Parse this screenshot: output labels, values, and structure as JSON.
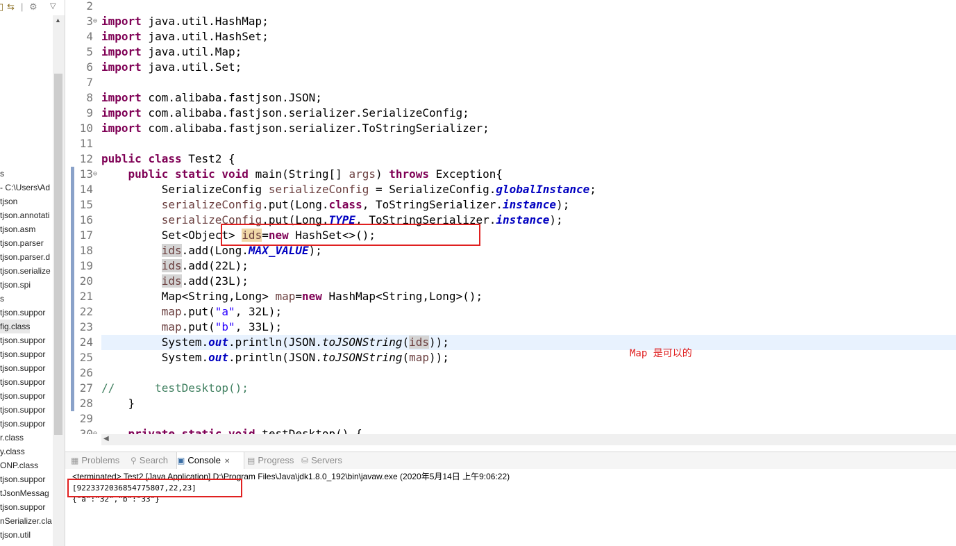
{
  "explorer": {
    "items": [
      {
        "label": "s",
        "selected": false
      },
      {
        "label": "- C:\\Users\\Ad",
        "selected": false
      },
      {
        "label": "tjson",
        "selected": false
      },
      {
        "label": "tjson.annotati",
        "selected": false
      },
      {
        "label": "tjson.asm",
        "selected": false
      },
      {
        "label": "tjson.parser",
        "selected": false
      },
      {
        "label": "tjson.parser.d",
        "selected": false
      },
      {
        "label": "tjson.serialize",
        "selected": false
      },
      {
        "label": "tjson.spi",
        "selected": false
      },
      {
        "label": "s",
        "selected": false
      },
      {
        "label": "tjson.suppor",
        "selected": false
      },
      {
        "label": "fig.class",
        "selected": true
      },
      {
        "label": "tjson.suppor",
        "selected": false
      },
      {
        "label": "tjson.suppor",
        "selected": false
      },
      {
        "label": "tjson.suppor",
        "selected": false
      },
      {
        "label": "tjson.suppor",
        "selected": false
      },
      {
        "label": "tjson.suppor",
        "selected": false
      },
      {
        "label": "tjson.suppor",
        "selected": false
      },
      {
        "label": "tjson.suppor",
        "selected": false
      },
      {
        "label": "r.class",
        "selected": false
      },
      {
        "label": "y.class",
        "selected": false
      },
      {
        "label": "ONP.class",
        "selected": false
      },
      {
        "label": "tjson.suppor",
        "selected": false
      },
      {
        "label": "tJsonMessag",
        "selected": false
      },
      {
        "label": "tjson.suppor",
        "selected": false
      },
      {
        "label": "nSerializer.cla",
        "selected": false
      },
      {
        "label": "tjson.util",
        "selected": false
      }
    ]
  },
  "editor": {
    "lines": [
      {
        "n": "2",
        "fold": false,
        "cur": false,
        "code": [
          {
            "t": "",
            "c": ""
          }
        ]
      },
      {
        "n": "3",
        "fold": true,
        "cur": false,
        "code": [
          {
            "t": "import",
            "c": "kw"
          },
          {
            "t": " java.util.HashMap;",
            "c": ""
          }
        ]
      },
      {
        "n": "4",
        "fold": false,
        "cur": false,
        "code": [
          {
            "t": "import",
            "c": "kw"
          },
          {
            "t": " java.util.HashSet;",
            "c": ""
          }
        ]
      },
      {
        "n": "5",
        "fold": false,
        "cur": false,
        "code": [
          {
            "t": "import",
            "c": "kw"
          },
          {
            "t": " java.util.Map;",
            "c": ""
          }
        ]
      },
      {
        "n": "6",
        "fold": false,
        "cur": false,
        "code": [
          {
            "t": "import",
            "c": "kw"
          },
          {
            "t": " java.util.Set;",
            "c": ""
          }
        ]
      },
      {
        "n": "7",
        "fold": false,
        "cur": false,
        "code": [
          {
            "t": "",
            "c": ""
          }
        ]
      },
      {
        "n": "8",
        "fold": false,
        "cur": false,
        "code": [
          {
            "t": "import",
            "c": "kw"
          },
          {
            "t": " com.alibaba.fastjson.JSON;",
            "c": ""
          }
        ]
      },
      {
        "n": "9",
        "fold": false,
        "cur": false,
        "code": [
          {
            "t": "import",
            "c": "kw"
          },
          {
            "t": " com.alibaba.fastjson.serializer.SerializeConfig;",
            "c": ""
          }
        ]
      },
      {
        "n": "10",
        "fold": false,
        "cur": false,
        "code": [
          {
            "t": "import",
            "c": "kw"
          },
          {
            "t": " com.alibaba.fastjson.serializer.ToStringSerializer;",
            "c": ""
          }
        ]
      },
      {
        "n": "11",
        "fold": false,
        "cur": false,
        "code": [
          {
            "t": "",
            "c": ""
          }
        ]
      },
      {
        "n": "12",
        "fold": false,
        "cur": false,
        "code": [
          {
            "t": "public",
            "c": "kw"
          },
          {
            "t": " ",
            "c": ""
          },
          {
            "t": "class",
            "c": "kw"
          },
          {
            "t": " Test2 {",
            "c": ""
          }
        ]
      },
      {
        "n": "13",
        "fold": true,
        "cur": false,
        "code": [
          {
            "t": "    ",
            "c": ""
          },
          {
            "t": "public",
            "c": "kw"
          },
          {
            "t": " ",
            "c": ""
          },
          {
            "t": "static",
            "c": "kw"
          },
          {
            "t": " ",
            "c": ""
          },
          {
            "t": "void",
            "c": "kw"
          },
          {
            "t": " main(String[] ",
            "c": ""
          },
          {
            "t": "args",
            "c": "var"
          },
          {
            "t": ") ",
            "c": ""
          },
          {
            "t": "throws",
            "c": "kw"
          },
          {
            "t": " Exception{",
            "c": ""
          }
        ]
      },
      {
        "n": "14",
        "fold": false,
        "cur": false,
        "code": [
          {
            "t": "         SerializeConfig ",
            "c": ""
          },
          {
            "t": "serializeConfig",
            "c": "var"
          },
          {
            "t": " = SerializeConfig.",
            "c": ""
          },
          {
            "t": "globalInstance",
            "c": "sfld"
          },
          {
            "t": ";",
            "c": ""
          }
        ]
      },
      {
        "n": "15",
        "fold": false,
        "cur": false,
        "code": [
          {
            "t": "         ",
            "c": ""
          },
          {
            "t": "serializeConfig",
            "c": "var"
          },
          {
            "t": ".put(Long.",
            "c": ""
          },
          {
            "t": "class",
            "c": "kw"
          },
          {
            "t": ", ToStringSerializer.",
            "c": ""
          },
          {
            "t": "instance",
            "c": "sfld"
          },
          {
            "t": ");",
            "c": ""
          }
        ]
      },
      {
        "n": "16",
        "fold": false,
        "cur": false,
        "code": [
          {
            "t": "         ",
            "c": ""
          },
          {
            "t": "serializeConfig",
            "c": "var"
          },
          {
            "t": ".put(Long.",
            "c": ""
          },
          {
            "t": "TYPE",
            "c": "sfld"
          },
          {
            "t": ", ToStringSerializer.",
            "c": ""
          },
          {
            "t": "instance",
            "c": "sfld"
          },
          {
            "t": ");",
            "c": ""
          }
        ]
      },
      {
        "n": "17",
        "fold": false,
        "cur": false,
        "code": [
          {
            "t": "         Set<Object> ",
            "c": ""
          },
          {
            "t": "ids",
            "c": "var occw"
          },
          {
            "t": "=",
            "c": ""
          },
          {
            "t": "new",
            "c": "kw"
          },
          {
            "t": " HashSet<>();",
            "c": ""
          }
        ]
      },
      {
        "n": "18",
        "fold": false,
        "cur": false,
        "code": [
          {
            "t": "         ",
            "c": ""
          },
          {
            "t": "ids",
            "c": "var occ"
          },
          {
            "t": ".add(Long.",
            "c": ""
          },
          {
            "t": "MAX_VALUE",
            "c": "sfld"
          },
          {
            "t": ");",
            "c": ""
          }
        ]
      },
      {
        "n": "19",
        "fold": false,
        "cur": false,
        "code": [
          {
            "t": "         ",
            "c": ""
          },
          {
            "t": "ids",
            "c": "var occ"
          },
          {
            "t": ".add(22L);",
            "c": ""
          }
        ]
      },
      {
        "n": "20",
        "fold": false,
        "cur": false,
        "code": [
          {
            "t": "         ",
            "c": ""
          },
          {
            "t": "ids",
            "c": "var occ"
          },
          {
            "t": ".add(23L);",
            "c": ""
          }
        ]
      },
      {
        "n": "21",
        "fold": false,
        "cur": false,
        "code": [
          {
            "t": "         Map<String,Long> ",
            "c": ""
          },
          {
            "t": "map",
            "c": "var"
          },
          {
            "t": "=",
            "c": ""
          },
          {
            "t": "new",
            "c": "kw"
          },
          {
            "t": " HashMap<String,Long>();",
            "c": ""
          }
        ]
      },
      {
        "n": "22",
        "fold": false,
        "cur": false,
        "code": [
          {
            "t": "         ",
            "c": ""
          },
          {
            "t": "map",
            "c": "var"
          },
          {
            "t": ".put(",
            "c": ""
          },
          {
            "t": "\"a\"",
            "c": "str"
          },
          {
            "t": ", 32L);",
            "c": ""
          }
        ]
      },
      {
        "n": "23",
        "fold": false,
        "cur": false,
        "code": [
          {
            "t": "         ",
            "c": ""
          },
          {
            "t": "map",
            "c": "var"
          },
          {
            "t": ".put(",
            "c": ""
          },
          {
            "t": "\"b\"",
            "c": "str"
          },
          {
            "t": ", 33L);",
            "c": ""
          }
        ]
      },
      {
        "n": "24",
        "fold": false,
        "cur": true,
        "code": [
          {
            "t": "         System.",
            "c": ""
          },
          {
            "t": "out",
            "c": "sfld"
          },
          {
            "t": ".println(JSON.",
            "c": ""
          },
          {
            "t": "toJSONString",
            "c": "smeth"
          },
          {
            "t": "(",
            "c": ""
          },
          {
            "t": "ids",
            "c": "var occ"
          },
          {
            "t": "));",
            "c": ""
          }
        ]
      },
      {
        "n": "25",
        "fold": false,
        "cur": false,
        "code": [
          {
            "t": "         System.",
            "c": ""
          },
          {
            "t": "out",
            "c": "sfld"
          },
          {
            "t": ".println(JSON.",
            "c": ""
          },
          {
            "t": "toJSONString",
            "c": "smeth"
          },
          {
            "t": "(",
            "c": ""
          },
          {
            "t": "map",
            "c": "var"
          },
          {
            "t": "));",
            "c": ""
          }
        ]
      },
      {
        "n": "26",
        "fold": false,
        "cur": false,
        "code": [
          {
            "t": "",
            "c": ""
          }
        ]
      },
      {
        "n": "27",
        "fold": false,
        "cur": false,
        "code": [
          {
            "t": "//      testDesktop();",
            "c": "cmt"
          }
        ]
      },
      {
        "n": "28",
        "fold": false,
        "cur": false,
        "code": [
          {
            "t": "    }",
            "c": ""
          }
        ]
      },
      {
        "n": "29",
        "fold": false,
        "cur": false,
        "code": [
          {
            "t": "",
            "c": ""
          }
        ]
      },
      {
        "n": "30",
        "fold": true,
        "cur": false,
        "code": [
          {
            "t": "    ",
            "c": ""
          },
          {
            "t": "private",
            "c": "kw"
          },
          {
            "t": " ",
            "c": ""
          },
          {
            "t": "static",
            "c": "kw"
          },
          {
            "t": " ",
            "c": ""
          },
          {
            "t": "void",
            "c": "kw"
          },
          {
            "t": " testDesktop() {",
            "c": ""
          }
        ]
      }
    ],
    "annotation": "Map 是可以的"
  },
  "views": {
    "tabs": [
      {
        "label": "Problems",
        "icon": "problems-icon",
        "glyph": "▦",
        "active": false
      },
      {
        "label": "Search",
        "icon": "search-icon",
        "glyph": "⚲",
        "active": false
      },
      {
        "label": "Console",
        "icon": "console-icon",
        "glyph": "▣",
        "active": true,
        "close": "✕"
      },
      {
        "label": "Progress",
        "icon": "progress-icon",
        "glyph": "▤",
        "active": false
      },
      {
        "label": "Servers",
        "icon": "servers-icon",
        "glyph": "⛁",
        "active": false
      }
    ]
  },
  "console": {
    "status": "<terminated> Test2 [Java Application] D:\\Program Files\\Java\\jdk1.8.0_192\\bin\\javaw.exe (2020年5月14日 上午9:06:22)",
    "output": [
      "[9223372036854775807,22,23]",
      "{\"a\":\"32\",\"b\":\"33\"}"
    ]
  },
  "colors": {
    "highlight_box": "#e02020",
    "keyword": "#7f0055",
    "field": "#0000c0",
    "string": "#2a00ff",
    "comment": "#3f7f5f"
  }
}
